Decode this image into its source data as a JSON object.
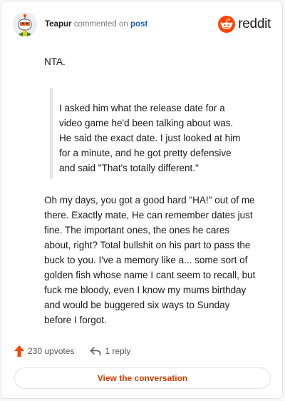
{
  "header": {
    "username": "Teapur",
    "commented_on": "commented on",
    "post_link": "post",
    "brand": "reddit"
  },
  "comment": {
    "opening": "NTA.",
    "quote_lines": [
      "I asked him what the release date for a",
      "video game he'd been talking about was.",
      "He said the exact date. I just looked at him",
      "for a minute, and he got pretty defensive",
      "and said \"That's totally different.\""
    ],
    "body_lines": [
      "Oh my days, you got a good hard \"HA!\" out of me",
      "there. Exactly mate, He can remember dates just",
      "fine. The important ones, the ones he cares",
      "about, right? Total bullshit on his part to pass the",
      "buck to you. I've a memory like a... some sort of",
      "golden fish whose name I cant seem to recall, but",
      "fuck me bloody, even I know my mums birthday",
      "and would be buggered six ways to Sunday",
      "before I forgot."
    ]
  },
  "actions": {
    "upvotes": "230 upvotes",
    "replies": "1 reply"
  },
  "cta": {
    "label": "View the conversation"
  },
  "colors": {
    "accent": "#d93a00",
    "upvote": "#ff4500",
    "link": "#1a5fb4"
  },
  "icons": [
    "avatar",
    "reddit-logo-icon",
    "upvote-arrow-icon",
    "reply-arrow-icon"
  ]
}
